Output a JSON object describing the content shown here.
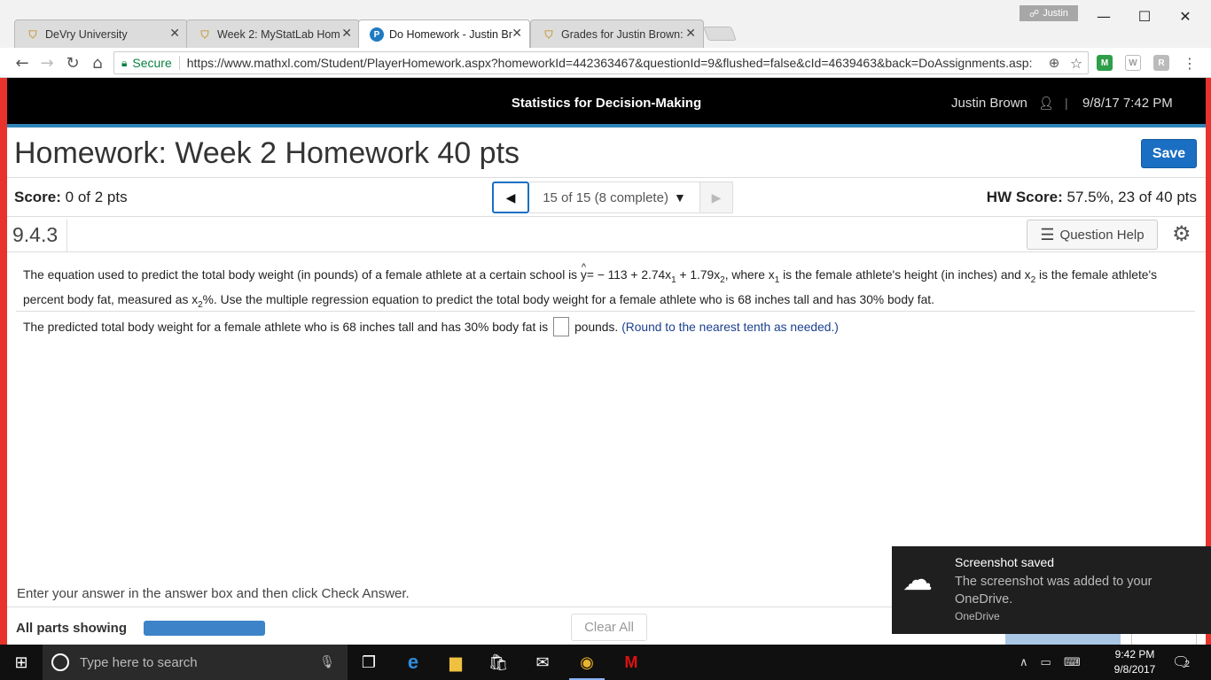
{
  "browser": {
    "profile": "Justin",
    "tabs": [
      {
        "label": "DeVry University",
        "favicon": "shield-icon"
      },
      {
        "label": "Week 2: MyStatLab Hom",
        "favicon": "shield-icon"
      },
      {
        "label": "Do Homework - Justin Br",
        "favicon": "pearson-icon"
      },
      {
        "label": "Grades for Justin Brown:",
        "favicon": "shield-icon"
      }
    ],
    "secure_label": "Secure",
    "url": "https://www.mathxl.com/Student/PlayerHomework.aspx?homeworkId=442363467&questionId=9&flushed=false&cId=4639463&back=DoAssignments.asp:"
  },
  "header": {
    "course_title": "Statistics for Decision-Making",
    "user_name": "Justin Brown",
    "datetime": "9/8/17 7:42 PM"
  },
  "homework": {
    "title": "Homework: Week 2 Homework 40 pts",
    "save_label": "Save",
    "score_label": "Score:",
    "score_value": "0 of 2 pts",
    "question_selector": "15 of 15 (8 complete)",
    "hw_score_label": "HW Score:",
    "hw_score_value": "57.5%, 23 of 40 pts",
    "question_number": "9.4.3",
    "question_help": "Question Help"
  },
  "question": {
    "part1": "The equation used to predict the total body weight (in pounds) of a female athlete at a certain school is ",
    "yhat": "y",
    "equation": "= − 113 + 2.74x",
    "sub1": "1",
    "eq_mid": " + 1.79x",
    "sub2": "2",
    "part2": ", where x",
    "sub3": "1",
    "part3": " is the female athlete's height (in inches) and x",
    "sub4": "2",
    "part4": " is the female athlete's percent body fat, measured as x",
    "sub5": "2",
    "part5": "%. Use the multiple regression equation to predict the total body weight for a female athlete who is 68 inches tall and has 30% body fat.",
    "answer_prefix": "The predicted total body weight for a female athlete who is 68 inches tall and has 30% body fat is",
    "answer_suffix": "pounds.",
    "round_note": "(Round to the nearest tenth as needed.)"
  },
  "footer": {
    "instruction": "Enter your answer in the answer box and then click Check Answer.",
    "parts_label": "All parts showing",
    "progress": 1.0,
    "clear_all": "Clear All"
  },
  "toast": {
    "title": "Screenshot saved",
    "body": "The screenshot was added to your OneDrive.",
    "app": "OneDrive"
  },
  "taskbar": {
    "search_placeholder": "Type here to search",
    "time": "9:42 PM",
    "date": "9/8/2017",
    "notification_count": "2"
  }
}
